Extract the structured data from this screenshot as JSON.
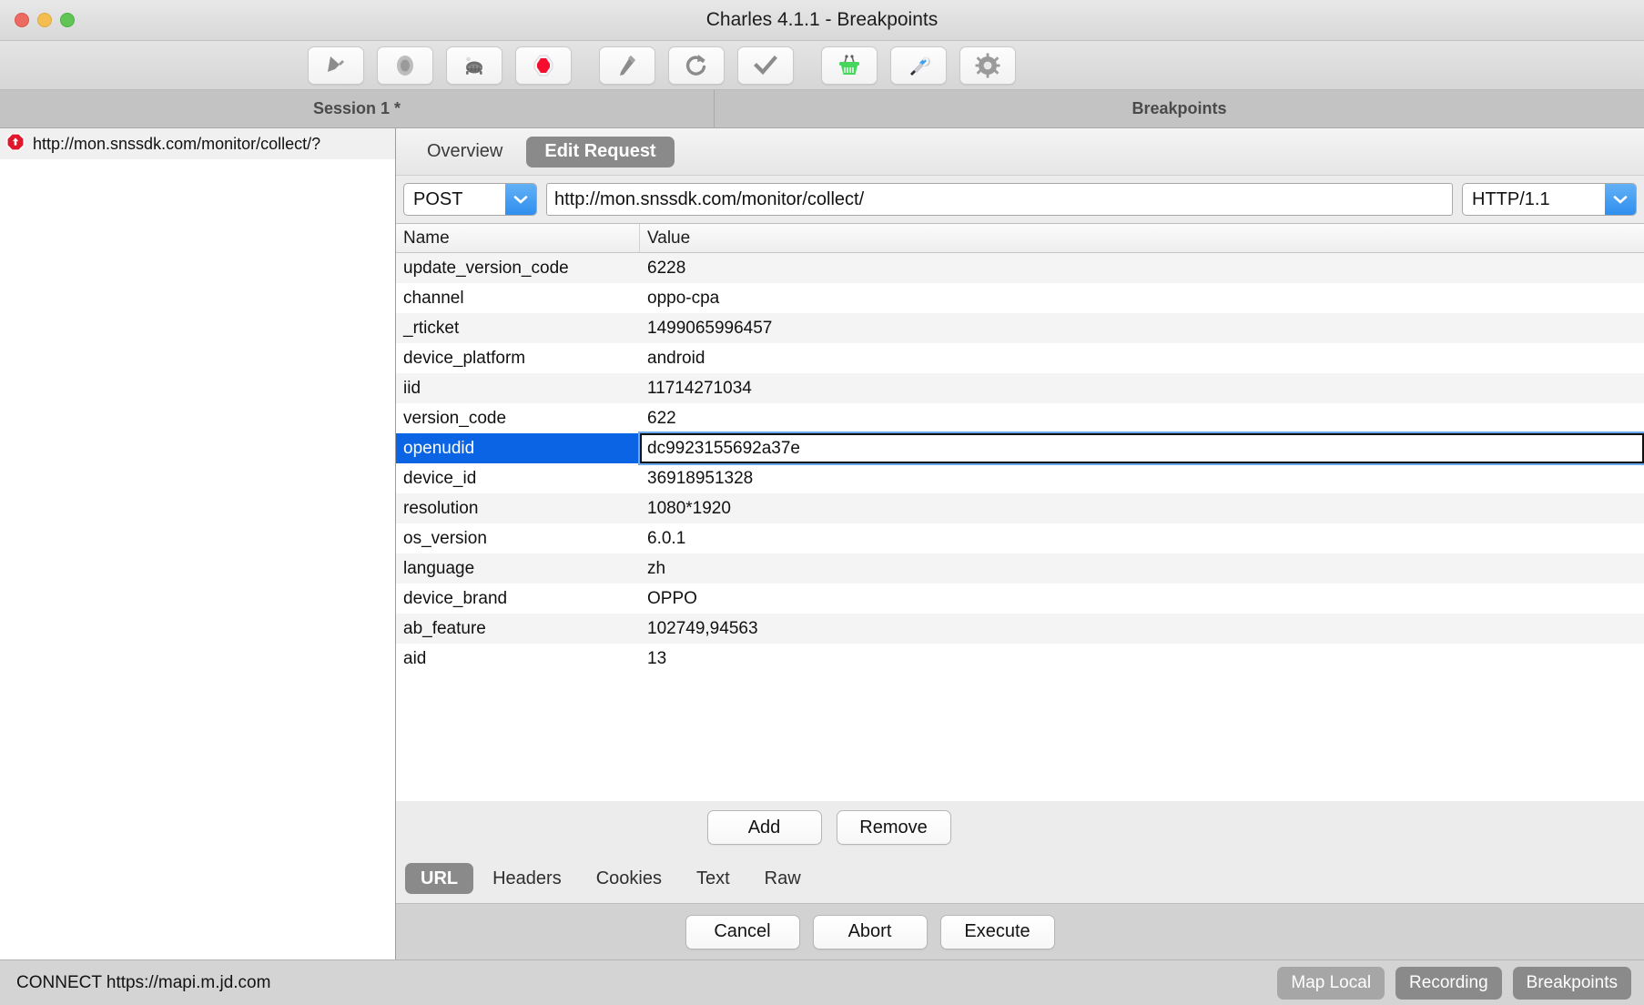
{
  "window": {
    "title": "Charles 4.1.1 - Breakpoints",
    "traffic_lights": [
      "close-button",
      "minimize-button",
      "zoom-button"
    ]
  },
  "toolbar": {
    "buttons": [
      {
        "name": "clear-session",
        "icon": "broom-icon"
      },
      {
        "name": "record",
        "icon": "record-circle-icon"
      },
      {
        "name": "throttle",
        "icon": "turtle-icon"
      },
      {
        "name": "breakpoints",
        "icon": "red-stop-icon"
      },
      {
        "name": "compose",
        "icon": "pen-icon"
      },
      {
        "name": "repeat",
        "icon": "refresh-icon"
      },
      {
        "name": "validate",
        "icon": "checkmark-icon"
      },
      {
        "name": "map-local",
        "icon": "green-basket-icon"
      },
      {
        "name": "tools",
        "icon": "wrench-screwdriver-icon"
      },
      {
        "name": "settings",
        "icon": "gear-icon"
      }
    ]
  },
  "tabstrip": {
    "session_tab": "Session 1 *",
    "breakpoints_tab": "Breakpoints"
  },
  "sidebar": {
    "rows": [
      {
        "icon": "breakpoint-stop-icon",
        "label": "http://mon.snssdk.com/monitor/collect/?"
      }
    ]
  },
  "editor": {
    "tabs": [
      {
        "label": "Overview",
        "active": false
      },
      {
        "label": "Edit Request",
        "active": true
      }
    ],
    "method": "POST",
    "url": "http://mon.snssdk.com/monitor/collect/",
    "http_version": "HTTP/1.1",
    "table": {
      "headers": [
        "Name",
        "Value"
      ],
      "rows": [
        {
          "name": "update_version_code",
          "value": "6228",
          "selected": false
        },
        {
          "name": "channel",
          "value": "oppo-cpa",
          "selected": false
        },
        {
          "name": "_rticket",
          "value": "1499065996457",
          "selected": false
        },
        {
          "name": "device_platform",
          "value": "android",
          "selected": false
        },
        {
          "name": "iid",
          "value": "11714271034",
          "selected": false
        },
        {
          "name": "version_code",
          "value": "622",
          "selected": false
        },
        {
          "name": "openudid",
          "value": "dc9923155692a37e",
          "selected": true
        },
        {
          "name": "device_id",
          "value": "36918951328",
          "selected": false
        },
        {
          "name": "resolution",
          "value": "1080*1920",
          "selected": false
        },
        {
          "name": "os_version",
          "value": "6.0.1",
          "selected": false
        },
        {
          "name": "language",
          "value": "zh",
          "selected": false
        },
        {
          "name": "device_brand",
          "value": "OPPO",
          "selected": false
        },
        {
          "name": "ab_feature",
          "value": "102749,94563",
          "selected": false
        },
        {
          "name": "aid",
          "value": "13",
          "selected": false
        }
      ]
    },
    "add_label": "Add",
    "remove_label": "Remove",
    "subtabs": [
      {
        "label": "URL",
        "active": true
      },
      {
        "label": "Headers",
        "active": false
      },
      {
        "label": "Cookies",
        "active": false
      },
      {
        "label": "Text",
        "active": false
      },
      {
        "label": "Raw",
        "active": false
      }
    ],
    "actions": [
      {
        "label": "Cancel",
        "name": "cancel-button"
      },
      {
        "label": "Abort",
        "name": "abort-button"
      },
      {
        "label": "Execute",
        "name": "execute-button"
      }
    ]
  },
  "statusbar": {
    "message": "CONNECT https://mapi.m.jd.com",
    "toggles": [
      {
        "label": "Map Local",
        "state": "off"
      },
      {
        "label": "Recording",
        "state": "on"
      },
      {
        "label": "Breakpoints",
        "state": "on"
      }
    ]
  },
  "colors": {
    "selection_blue": "#0a64e4",
    "combo_blue": "#2f8fee",
    "tab_active_gray": "#8a8a8a",
    "window_chrome": "#d8d8d8"
  }
}
